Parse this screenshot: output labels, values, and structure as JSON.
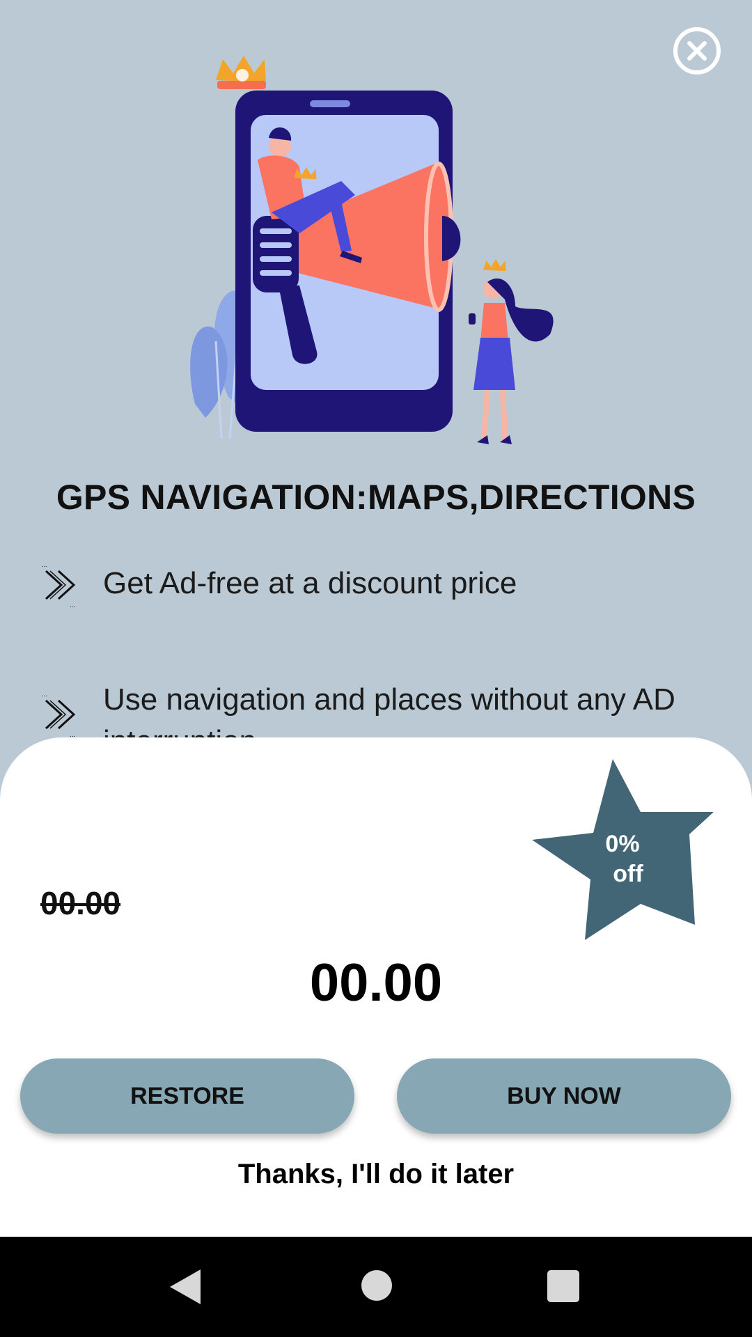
{
  "header": {
    "close_icon": "close-circle-icon"
  },
  "hero": {
    "illustration": "phone-megaphone-illustration"
  },
  "title": "GPS NAVIGATION:MAPS,DIRECTIONS",
  "features": [
    {
      "icon": "double-chevron-right-icon",
      "text": "Get Ad-free at a discount price"
    },
    {
      "icon": "double-chevron-right-icon",
      "text": "Use navigation and places without any AD interruption"
    }
  ],
  "offer": {
    "discount_line1": "0%",
    "discount_line2": "off",
    "star_color": "#426675",
    "old_price": "00.00",
    "new_price": "00.00"
  },
  "buttons": {
    "restore": "RESTORE",
    "buy_now": "BUY NOW",
    "later": "Thanks, I'll do it later"
  },
  "colors": {
    "background": "#bac9d3",
    "button": "#87a7b5",
    "sheet": "#ffffff"
  },
  "navbar": {
    "icons": [
      "back-icon",
      "home-icon",
      "recents-icon"
    ]
  }
}
